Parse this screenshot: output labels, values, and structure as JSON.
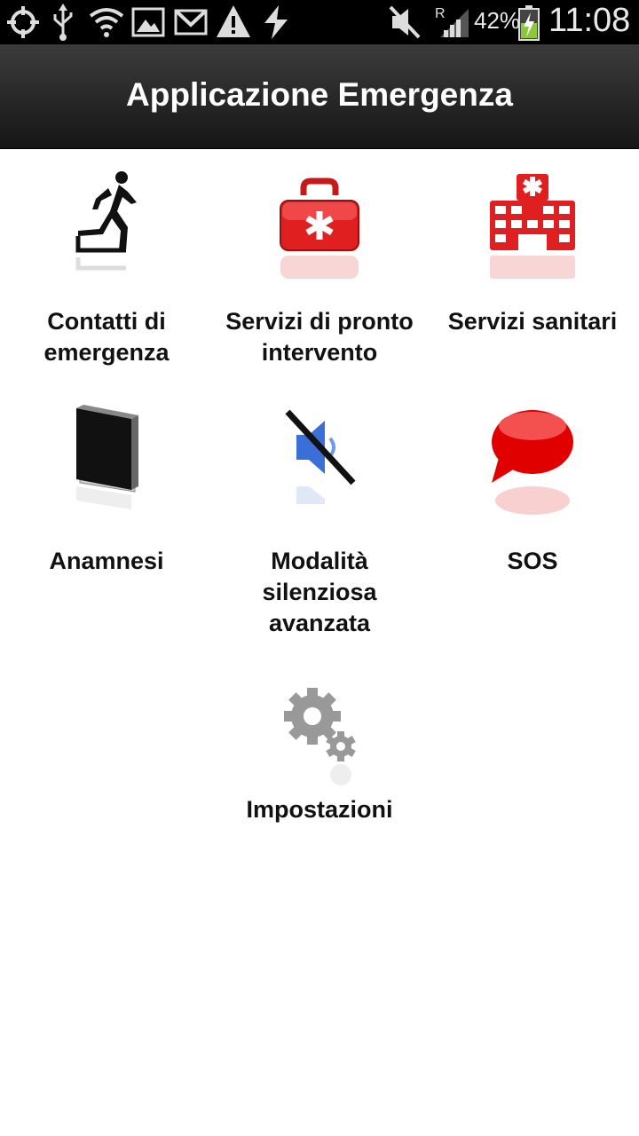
{
  "status_bar": {
    "battery_percent": "42%",
    "time": "11:08",
    "icons": [
      "gps-icon",
      "usb-icon",
      "wifi-question-icon",
      "gallery-icon",
      "gmail-icon",
      "warning-icon",
      "sync-icon",
      "mute-icon",
      "roaming-signal-icon",
      "battery-charging-icon"
    ]
  },
  "action_bar": {
    "title": "Applicazione Emergenza"
  },
  "menu": {
    "items": [
      {
        "label_lines": [
          "Contatti di",
          "emergenza"
        ],
        "icon": "running-man-exit-icon"
      },
      {
        "label_lines": [
          "Servizi di pronto",
          "intervento"
        ],
        "icon": "first-aid-kit-icon"
      },
      {
        "label_lines": [
          "Servizi sanitari"
        ],
        "icon": "hospital-icon"
      },
      {
        "label_lines": [
          "Anamnesi"
        ],
        "icon": "book-icon"
      },
      {
        "label_lines": [
          "Modalità",
          "silenziosa",
          "avanzata"
        ],
        "icon": "speaker-mute-icon"
      },
      {
        "label_lines": [
          "SOS"
        ],
        "icon": "speech-bubble-icon"
      },
      {
        "label_lines": [
          "Impostazioni"
        ],
        "icon": "gears-icon"
      }
    ]
  },
  "colors": {
    "accent_red": "#e02020",
    "action_bar_dark": "#161616",
    "status_bar": "#000000"
  }
}
